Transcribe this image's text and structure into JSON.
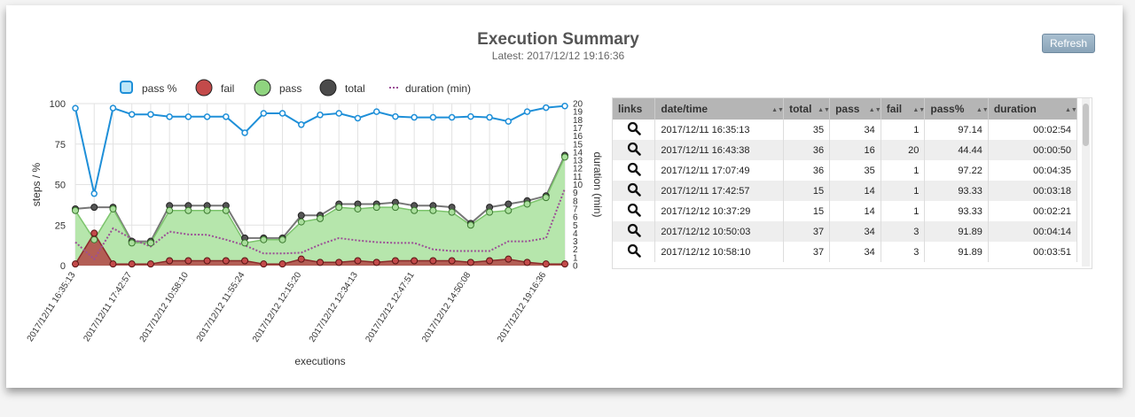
{
  "header": {
    "title": "Execution Summary",
    "subtitle": "Latest: 2017/12/12 19:16:36",
    "refresh_label": "Refresh"
  },
  "colors": {
    "pass_pct": "#1e8fd8",
    "fail": "#c34a4a",
    "pass": "#8fd47f",
    "total": "#4a4a4a",
    "duration": "#9b4f96"
  },
  "chart_data": {
    "type": "line",
    "legend": [
      "pass %",
      "fail",
      "pass",
      "total",
      "duration (min)"
    ],
    "legend_position": "top",
    "xlabel": "executions",
    "ylabel": "steps / %",
    "y2label": "duration (min)",
    "ylim": [
      0,
      100
    ],
    "y2lim": [
      0,
      20
    ],
    "yticks": [
      0,
      25,
      50,
      75,
      100
    ],
    "y2ticks": [
      0,
      1,
      2,
      3,
      4,
      5,
      6,
      7,
      8,
      9,
      10,
      11,
      12,
      13,
      14,
      15,
      16,
      17,
      18,
      19,
      20
    ],
    "grid": true,
    "xticklabels": [
      "2017/12/11 16:35:13",
      "2017/12/11 17:42:57",
      "2017/12/12 10:58:10",
      "2017/12/12 11:55:24",
      "2017/12/12 12:15:20",
      "2017/12/12 12:34:13",
      "2017/12/12 12:47:51",
      "2017/12/12 14:50:08",
      "2017/12/12 19:16:36"
    ],
    "xtick_index": [
      0,
      3,
      6,
      9,
      12,
      15,
      18,
      21,
      25
    ],
    "series": [
      {
        "name": "pass %",
        "values": [
          97.14,
          44.44,
          97.22,
          93.33,
          93.33,
          91.89,
          91.89,
          91.89,
          91.89,
          82,
          94,
          94,
          87,
          93,
          94,
          91,
          95,
          92,
          91.5,
          91.5,
          91.5,
          92,
          91.5,
          89,
          95,
          97.5,
          98.5
        ]
      },
      {
        "name": "fail",
        "values": [
          1,
          20,
          1,
          1,
          1,
          3,
          3,
          3,
          3,
          3,
          1,
          1,
          4,
          2,
          2,
          3,
          2,
          3,
          3,
          3,
          3,
          2,
          3,
          4,
          2,
          1,
          1
        ]
      },
      {
        "name": "pass",
        "values": [
          34,
          16,
          35,
          14,
          14,
          34,
          34,
          34,
          34,
          14,
          16,
          16,
          27,
          29,
          36,
          35,
          36,
          36,
          34,
          34,
          33,
          25,
          33,
          34,
          38,
          42,
          67
        ]
      },
      {
        "name": "total",
        "values": [
          35,
          36,
          36,
          15,
          15,
          37,
          37,
          37,
          37,
          17,
          17,
          17,
          31,
          31,
          38,
          38,
          38,
          39,
          37,
          37,
          36,
          26,
          36,
          38,
          40,
          43,
          68
        ]
      },
      {
        "name": "duration (min)",
        "values": [
          2.9,
          0.8,
          4.6,
          3.3,
          2.35,
          4.2,
          3.85,
          3.8,
          3.2,
          2.5,
          1.5,
          1.5,
          1.6,
          2.6,
          3.4,
          3.1,
          2.9,
          2.8,
          2.8,
          2.0,
          1.8,
          1.8,
          1.8,
          3.0,
          3.0,
          3.4,
          9.5
        ]
      }
    ]
  },
  "table": {
    "columns": [
      "links",
      "date/time",
      "total",
      "pass",
      "fail",
      "pass%",
      "duration"
    ],
    "rows": [
      {
        "datetime": "2017/12/11 16:35:13",
        "total": "35",
        "pass": "34",
        "fail": "1",
        "pass_pct": "97.14",
        "duration": "00:02:54"
      },
      {
        "datetime": "2017/12/11 16:43:38",
        "total": "36",
        "pass": "16",
        "fail": "20",
        "pass_pct": "44.44",
        "duration": "00:00:50"
      },
      {
        "datetime": "2017/12/11 17:07:49",
        "total": "36",
        "pass": "35",
        "fail": "1",
        "pass_pct": "97.22",
        "duration": "00:04:35"
      },
      {
        "datetime": "2017/12/11 17:42:57",
        "total": "15",
        "pass": "14",
        "fail": "1",
        "pass_pct": "93.33",
        "duration": "00:03:18"
      },
      {
        "datetime": "2017/12/12 10:37:29",
        "total": "15",
        "pass": "14",
        "fail": "1",
        "pass_pct": "93.33",
        "duration": "00:02:21"
      },
      {
        "datetime": "2017/12/12 10:50:03",
        "total": "37",
        "pass": "34",
        "fail": "3",
        "pass_pct": "91.89",
        "duration": "00:04:14"
      },
      {
        "datetime": "2017/12/12 10:58:10",
        "total": "37",
        "pass": "34",
        "fail": "3",
        "pass_pct": "91.89",
        "duration": "00:03:51"
      }
    ]
  }
}
